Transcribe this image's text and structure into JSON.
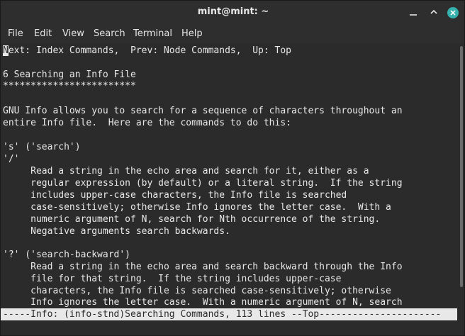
{
  "window": {
    "title": "mint@mint: ~"
  },
  "menu": [
    "File",
    "Edit",
    "View",
    "Search",
    "Terminal",
    "Help"
  ],
  "terminal": {
    "cursor_char": "N",
    "lines": [
      "ext: Index Commands,  Prev: Node Commands,  Up: Top",
      "",
      "6 Searching an Info File",
      "************************",
      "",
      "GNU Info allows you to search for a sequence of characters throughout an",
      "entire Info file.  Here are the commands to do this:",
      "",
      "'s' ('search')",
      "'/'",
      "     Read a string in the echo area and search for it, either as a",
      "     regular expression (by default) or a literal string.  If the string",
      "     includes upper-case characters, the Info file is searched",
      "     case-sensitively; otherwise Info ignores the letter case.  With a",
      "     numeric argument of N, search for Nth occurrence of the string.",
      "     Negative arguments search backwards.",
      "",
      "'?' ('search-backward')",
      "     Read a string in the echo area and search backward through the Info",
      "     file for that string.  If the string includes upper-case",
      "     characters, the Info file is searched case-sensitively; otherwise",
      "     Info ignores the letter case.  With a numeric argument of N, search"
    ],
    "status_line": "-----Info: (info-stnd)Searching Commands, 113 lines --Top----------------------"
  },
  "colors": {
    "accent": "#35b0ad",
    "terminal_bg": "#2b2b2b",
    "terminal_fg": "#e8e8e8"
  },
  "icons": {
    "minimize": "minimize-icon",
    "maximize": "maximize-icon",
    "close": "close-icon"
  }
}
